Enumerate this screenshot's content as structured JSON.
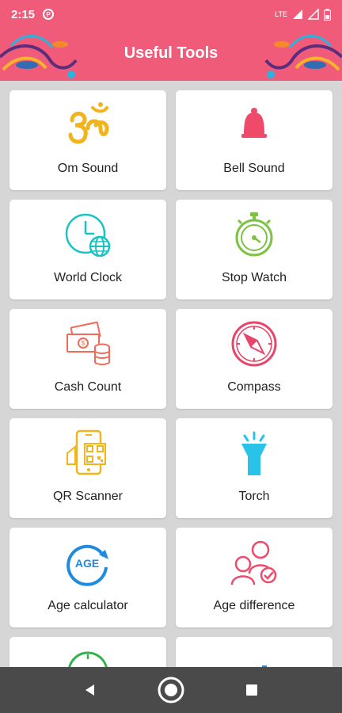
{
  "status": {
    "time": "2:15",
    "app_badge": "P",
    "network": "LTE"
  },
  "appbar": {
    "title": "Useful Tools",
    "brand_color": "#f15b7a"
  },
  "tools": [
    {
      "label": "Om Sound",
      "icon": "om-icon"
    },
    {
      "label": "Bell Sound",
      "icon": "bell-icon"
    },
    {
      "label": "World Clock",
      "icon": "world-clock-icon"
    },
    {
      "label": "Stop Watch",
      "icon": "stopwatch-icon"
    },
    {
      "label": "Cash Count",
      "icon": "cash-icon"
    },
    {
      "label": "Compass",
      "icon": "compass-icon"
    },
    {
      "label": "QR Scanner",
      "icon": "qr-scanner-icon"
    },
    {
      "label": "Torch",
      "icon": "torch-icon"
    },
    {
      "label": "Age calculator",
      "icon": "age-calculator-icon",
      "icon_text": "AGE"
    },
    {
      "label": "Age difference",
      "icon": "age-difference-icon"
    }
  ],
  "navbar": {
    "back": "back-icon",
    "home": "home-icon",
    "recents": "recents-icon"
  }
}
